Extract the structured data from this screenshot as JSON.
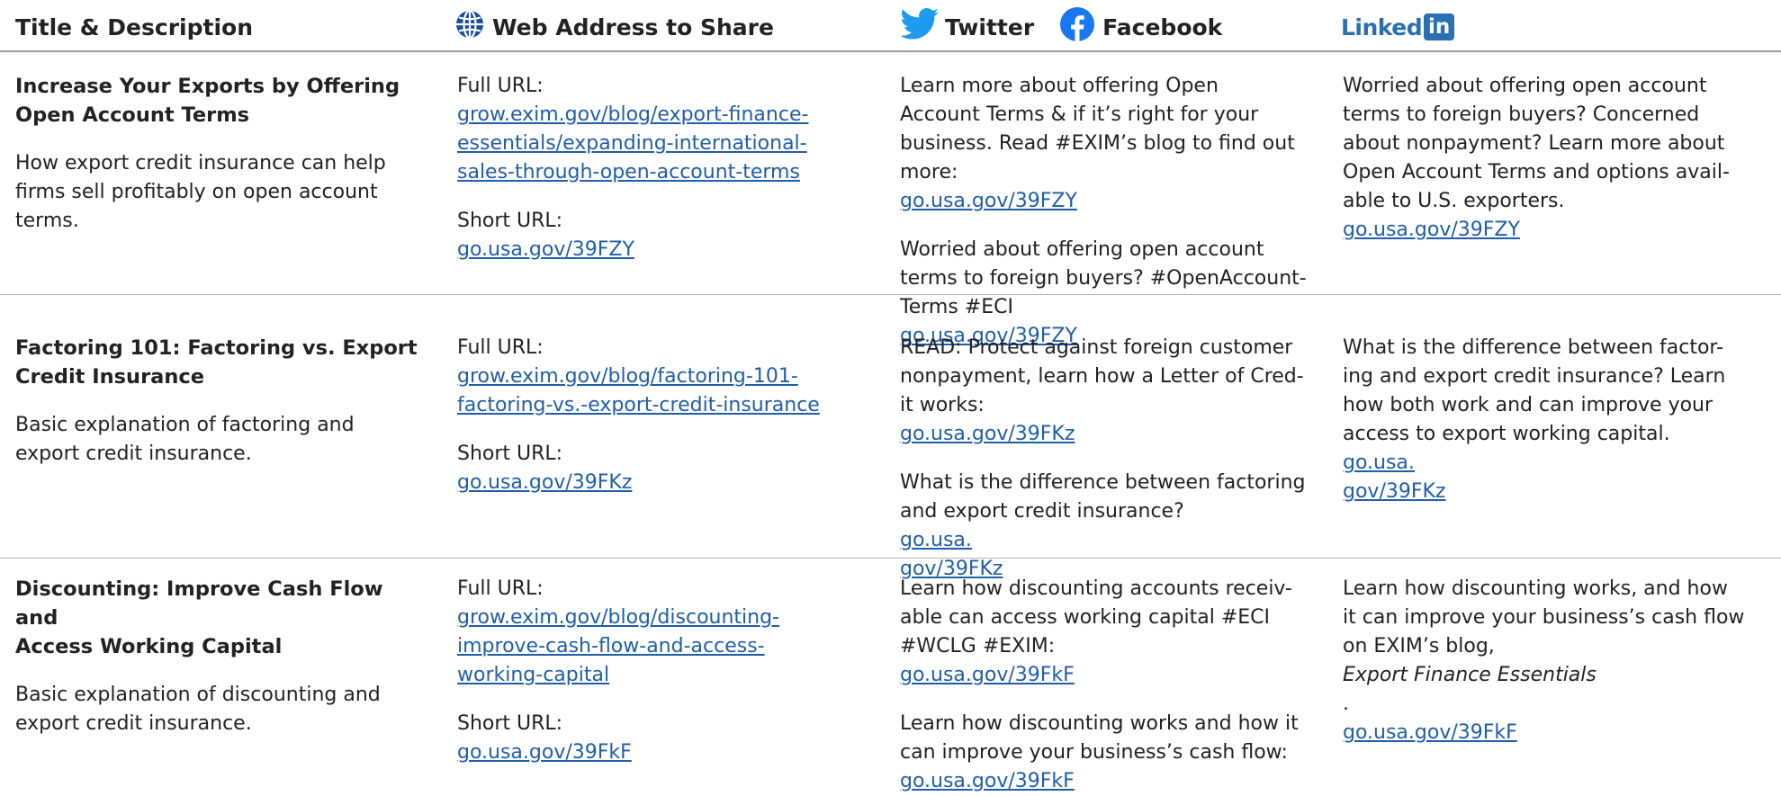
{
  "header": {
    "col1": "Title & Description",
    "col2": "Web Address to Share",
    "col3a": "Twitter",
    "col3b": "Facebook",
    "col4_text": "Linked",
    "col4_box": "in"
  },
  "labels": {
    "full_url": "Full URL:",
    "short_url": "Short URL:"
  },
  "rows": [
    {
      "title_lines": [
        "Increase Your Exports by Offering",
        "Open Account Terms"
      ],
      "desc_lines": [
        "How export credit insurance can help",
        "firms sell profitably on open account",
        "terms."
      ],
      "full_url_lines": [
        "grow.exim.gov/blog/export-finance-",
        "essentials/expanding-international-",
        "sales-through-open-account-terms"
      ],
      "short_url": "go.usa.gov/39FZY",
      "social1_lines": [
        "Learn more about offering Open",
        "Account Terms & if it’s right for your",
        "business. Read #EXIM’s blog to find out"
      ],
      "social1_last": "more: ",
      "social1_link": "go.usa.gov/39FZY",
      "social2_lines": [
        "Worried about offering open account",
        "terms to foreign buyers? #OpenAccount-"
      ],
      "social2_last": "Terms #ECI ",
      "social2_link": "go.usa.gov/39FZY",
      "linkedin_lines": [
        "Worried about offering open account",
        "terms to foreign buyers? Concerned",
        "about nonpayment? Learn more about",
        "Open Account Terms and options avail-"
      ],
      "linkedin_last": "able to U.S. exporters. ",
      "linkedin_link": "go.usa.gov/39FZY"
    },
    {
      "title_lines": [
        "Factoring 101: Factoring vs. Export",
        "Credit Insurance"
      ],
      "desc_lines": [
        "Basic explanation of factoring and",
        "export credit insurance."
      ],
      "full_url_lines": [
        "grow.exim.gov/blog/factoring-101-",
        "factoring-vs.-export-credit-insurance"
      ],
      "short_url": "go.usa.gov/39FKz",
      "social1_lines": [
        "READ: Protect against foreign customer",
        "nonpayment, learn how a Letter of Cred-"
      ],
      "social1_last": "it works: ",
      "social1_link": "go.usa.gov/39FKz",
      "social2_lines": [
        "What is the difference between factoring"
      ],
      "social2_last": "and export credit insurance? ",
      "social2_link1": "go.usa.",
      "social2_link2": "gov/39FKz",
      "linkedin_lines": [
        "What is the difference between factor-",
        "ing and export credit insurance? Learn",
        "how both work and can improve your"
      ],
      "linkedin_last": "access to export working capital. ",
      "linkedin_link1": "go.usa.",
      "linkedin_link2": "gov/39FKz"
    },
    {
      "title_lines": [
        "Discounting: Improve Cash Flow and",
        "Access Working Capital"
      ],
      "desc_lines": [
        "Basic explanation of discounting and",
        "export credit insurance."
      ],
      "full_url_lines": [
        "grow.exim.gov/blog/discounting-",
        "improve-cash-flow-and-access-",
        "working-capital"
      ],
      "short_url": "go.usa.gov/39FkF",
      "social1_lines": [
        "Learn how discounting accounts receiv-",
        "able can access working capital #ECI"
      ],
      "social1_last": "#WCLG #EXIM: ",
      "social1_link": "go.usa.gov/39FkF",
      "social2_lines": [
        "Learn how discounting works and how it",
        "can improve your business’s cash flow:"
      ],
      "social2_link": "go.usa.gov/39FkF",
      "linkedin_lines": [
        "Learn how discounting works, and how",
        "it can improve your business’s cash flow"
      ],
      "linkedin_last": "on EXIM’s blog, ",
      "linkedin_italic": "Export Finance Essentials",
      "linkedin_after": ".",
      "linkedin_link": "go.usa.gov/39FkF"
    }
  ],
  "colors": {
    "link": "#1f5ea8",
    "linkedin": "#2a6fb1",
    "twitter": "#1d9bf0",
    "facebook": "#1877f2",
    "globe": "#1a4f96"
  },
  "icons": [
    "globe-icon",
    "twitter-bird-icon",
    "facebook-icon",
    "linkedin-logo"
  ]
}
